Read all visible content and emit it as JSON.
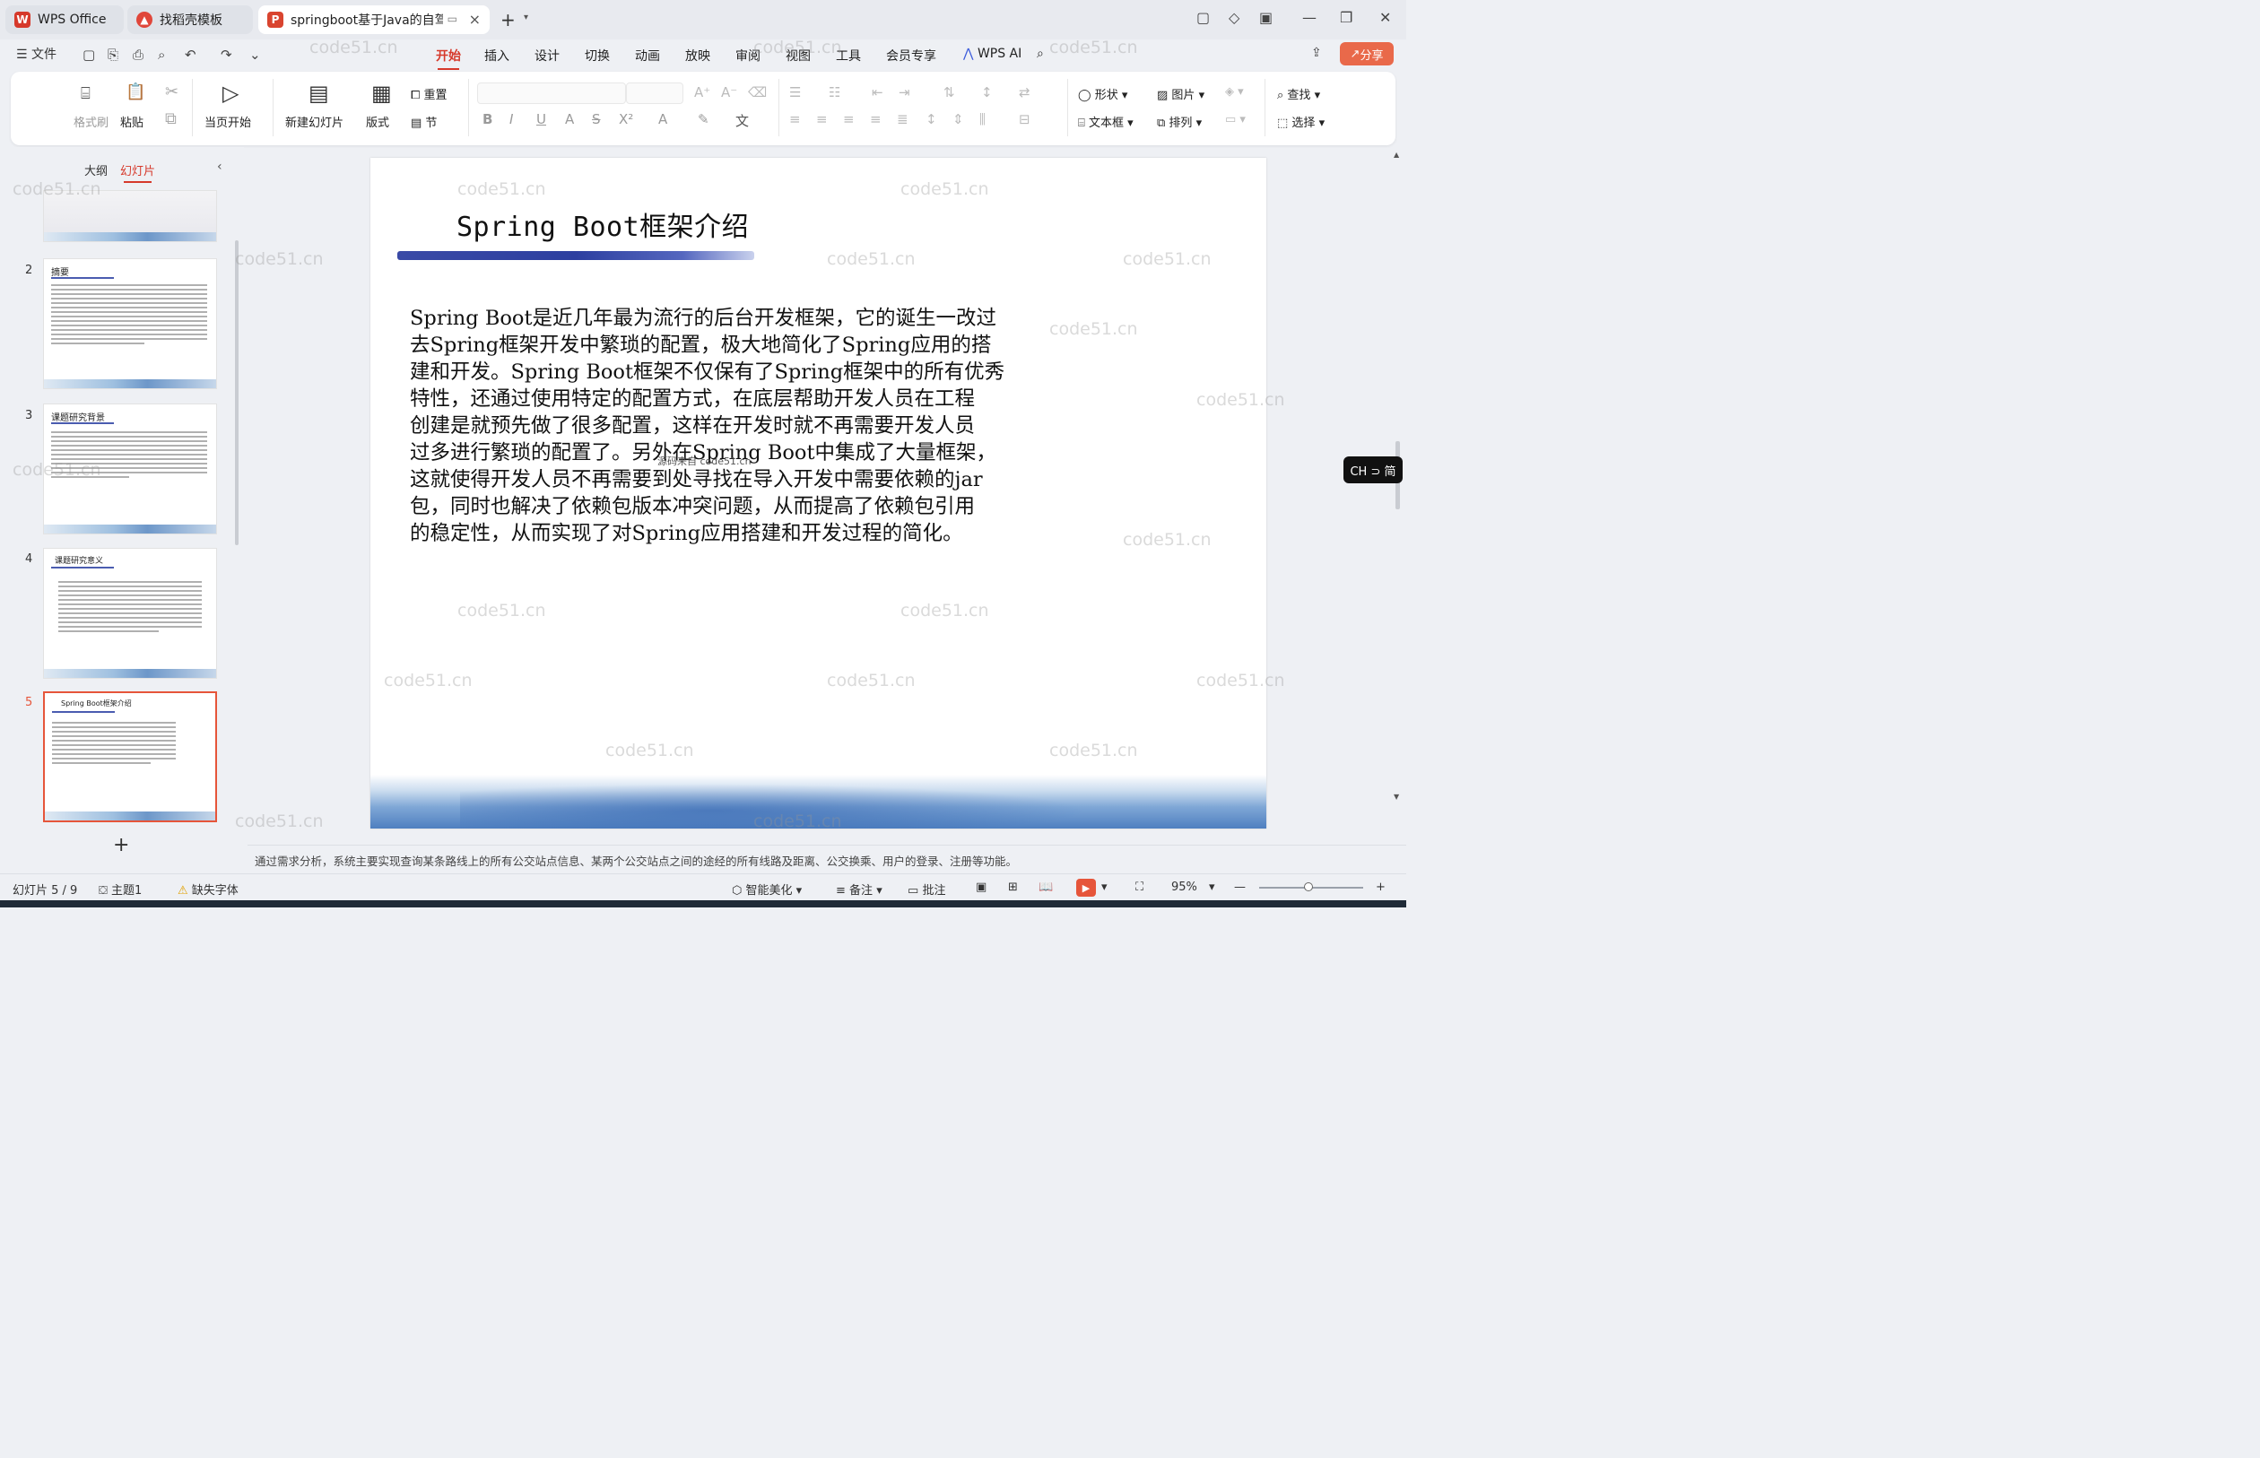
{
  "titlebar": {
    "tabs": [
      {
        "label": "WPS Office"
      },
      {
        "label": "找稻壳模板"
      },
      {
        "label": "springboot基于Java的自驾游"
      }
    ]
  },
  "menu": {
    "file": "文件",
    "items": [
      "开始",
      "插入",
      "设计",
      "切换",
      "动画",
      "放映",
      "审阅",
      "视图",
      "工具",
      "会员专享"
    ],
    "active": "开始",
    "wps_ai": "WPS AI",
    "share": "分享"
  },
  "ribbon": {
    "format_brush": "格式刷",
    "paste": "粘贴",
    "play_from_current": "当页开始",
    "new_slide": "新建幻灯片",
    "layout": "版式",
    "reset": "重置",
    "section": "节",
    "shape": "形状",
    "picture": "图片",
    "find": "查找",
    "textbox": "文本框",
    "arrange": "排列",
    "select": "选择"
  },
  "left_panel": {
    "tab_outline": "大纲",
    "tab_slides": "幻灯片",
    "active_tab": "幻灯片",
    "slides": [
      {
        "number": "2",
        "title": "摘要"
      },
      {
        "number": "3",
        "title": "课题研究背景"
      },
      {
        "number": "4",
        "title": "课题研究意义"
      },
      {
        "number": "5",
        "title": "Spring Boot框架介绍"
      }
    ],
    "selected": "5"
  },
  "slide": {
    "title": "Spring Boot框架介绍",
    "body_lines": [
      "Spring Boot是近几年最为流行的后台开发框架，它的诞生一改过",
      "去Spring框架开发中繁琐的配置，极大地简化了Spring应用的搭",
      "建和开发。Spring Boot框架不仅保有了Spring框架中的所有优秀",
      "特性，还通过使用特定的配置方式，在底层帮助开发人员在工程",
      "创建是就预先做了很多配置，这样在开发时就不再需要开发人员",
      "过多进行繁琐的配置了。另外在Spring Boot中集成了大量框架，",
      "这就使得开发人员不再需要到处寻找在导入开发中需要依赖的jar",
      "包，同时也解决了依赖包版本冲突问题，从而提高了依赖包引用",
      "的稳定性，从而实现了对Spring应用搭建和开发过程的简化。"
    ],
    "overlay_text": "源码来自 code51.cn"
  },
  "notes": {
    "text": "通过需求分析，系统主要实现查询某条路线上的所有公交站点信息、某两个公交站点之间的途经的所有线路及距离、公交换乘、用户的登录、注册等功能。"
  },
  "statusbar": {
    "slide_counter": "幻灯片 5 / 9",
    "theme": "主题1",
    "missing_font": "缺失字体",
    "smart_beautify": "智能美化",
    "notes": "备注",
    "comment": "批注",
    "zoom": "95%"
  },
  "ime": {
    "label": "CH ⊃ 简"
  },
  "watermark": "code51.cn",
  "colors": {
    "accent": "#d6392b",
    "share": "#e9694a",
    "selected_thumb": "#e6553a"
  }
}
